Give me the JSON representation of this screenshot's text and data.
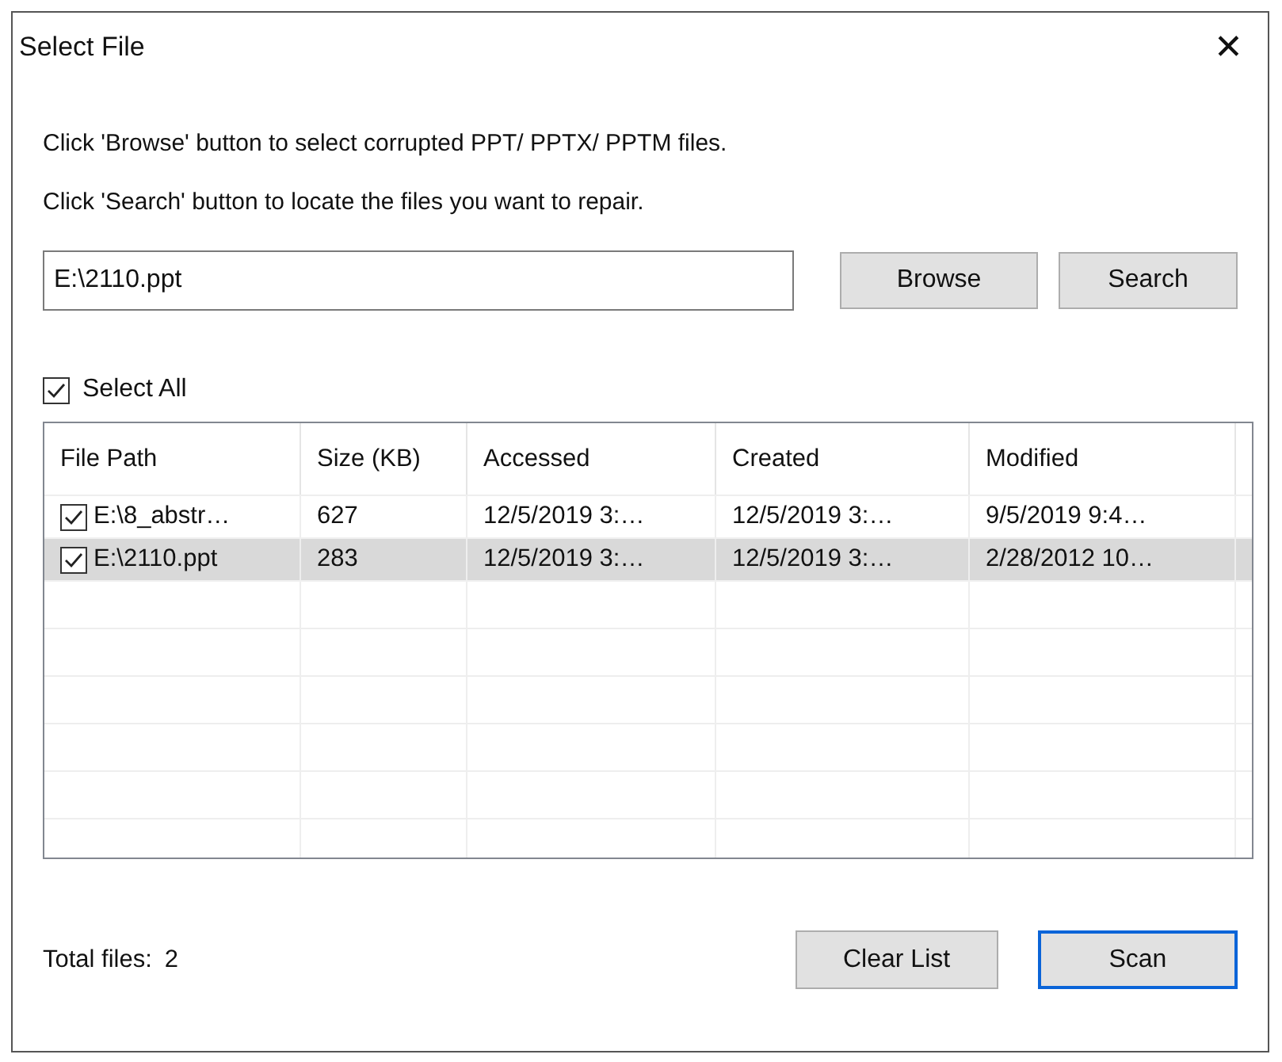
{
  "window": {
    "title": "Select File",
    "close": "✕"
  },
  "instructions": [
    "Click 'Browse' button to select corrupted PPT/ PPTX/ PPTM files.",
    "Click 'Search' button to locate the files you want to repair."
  ],
  "path_field": {
    "value": "E:\\2110.ppt"
  },
  "top_buttons": [
    {
      "label": "Browse",
      "default": false
    },
    {
      "label": "Search",
      "default": false
    }
  ],
  "select_all": {
    "label": "Select All",
    "checked": true
  },
  "table": {
    "columns": [
      "File Path",
      "Size (KB)",
      "Accessed",
      "Created",
      "Modified"
    ],
    "rows": [
      {
        "checked": true,
        "selected": false,
        "cells": [
          "E:\\8_abstr…",
          "627",
          "12/5/2019 3:…",
          "12/5/2019 3:…",
          "9/5/2019 9:4…"
        ]
      },
      {
        "checked": true,
        "selected": true,
        "cells": [
          "E:\\2110.ppt",
          "283",
          "12/5/2019 3:…",
          "12/5/2019 3:…",
          "2/28/2012 10…"
        ]
      }
    ]
  },
  "status": {
    "label": "Total files:",
    "value": "2"
  },
  "bottom_buttons": [
    {
      "label": "Clear List",
      "default": false
    },
    {
      "label": "Scan",
      "default": true
    }
  ]
}
